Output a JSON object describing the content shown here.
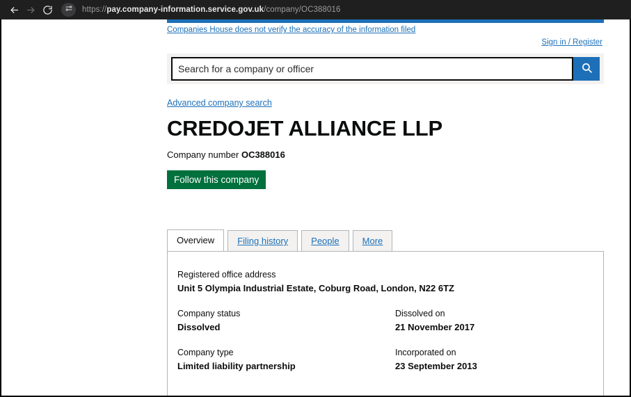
{
  "browser": {
    "back_icon": "back-arrow-icon",
    "forward_icon": "forward-arrow-icon",
    "reload_icon": "reload-icon",
    "site_settings_icon": "site-settings-sliders-icon",
    "url_scheme": "https://",
    "url_host": "pay.company-information.service.gov.uk",
    "url_path": "/company/OC388016",
    "url_full": "https://pay.company-information.service.gov.uk/company/OC388016"
  },
  "header": {
    "phase_banner_text": "Companies House does not verify the accuracy of the information filed",
    "signin_label": "Sign in / Register",
    "blue_bar_color": "#1d70b8"
  },
  "search": {
    "placeholder": "Search for a company or officer",
    "value": "",
    "button_icon": "search-icon",
    "button_color": "#1d70b8",
    "advanced_link_label": "Advanced company search"
  },
  "company": {
    "name": "CREDOJET ALLIANCE LLP",
    "number_label": "Company number",
    "number": "OC388016",
    "follow_button_label": "Follow this company",
    "follow_button_color": "#00703c"
  },
  "tabs": [
    {
      "label": "Overview",
      "active": true
    },
    {
      "label": "Filing history",
      "active": false
    },
    {
      "label": "People",
      "active": false
    },
    {
      "label": "More",
      "active": false
    }
  ],
  "overview": {
    "address_label": "Registered office address",
    "address_value": "Unit 5 Olympia Industrial Estate, Coburg Road, London, N22 6TZ",
    "status_label": "Company status",
    "status_value": "Dissolved",
    "dissolved_label": "Dissolved on",
    "dissolved_value": "21 November 2017",
    "type_label": "Company type",
    "type_value": "Limited liability partnership",
    "incorporated_label": "Incorporated on",
    "incorporated_value": "23 September 2013"
  }
}
